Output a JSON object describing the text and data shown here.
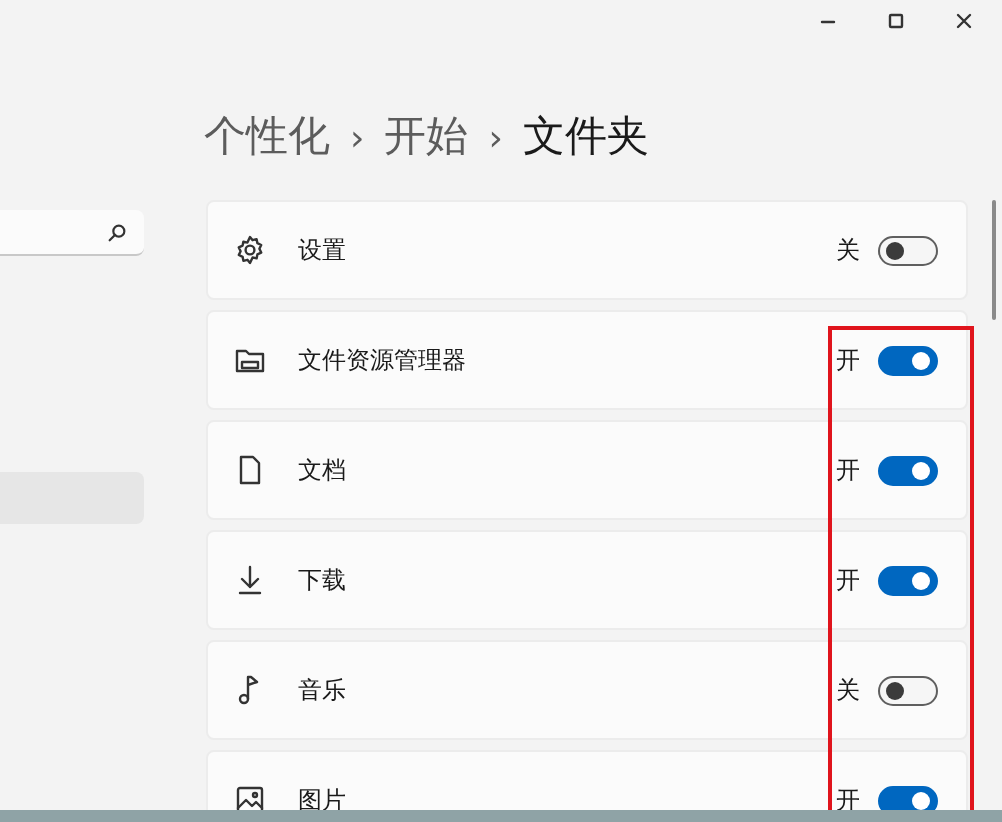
{
  "breadcrumb": [
    {
      "label": "个性化",
      "current": false
    },
    {
      "label": "开始",
      "current": false
    },
    {
      "label": "文件夹",
      "current": true
    }
  ],
  "breadcrumb_separator": "›",
  "sidebar": {
    "items": [
      {
        "selected": true
      }
    ]
  },
  "folders": [
    {
      "kind": "gear",
      "label": "设置",
      "state_text": "关",
      "on": false
    },
    {
      "kind": "explorer",
      "label": "文件资源管理器",
      "state_text": "开",
      "on": true
    },
    {
      "kind": "document",
      "label": "文档",
      "state_text": "开",
      "on": true
    },
    {
      "kind": "download",
      "label": "下载",
      "state_text": "开",
      "on": true
    },
    {
      "kind": "music",
      "label": "音乐",
      "state_text": "关",
      "on": false
    },
    {
      "kind": "picture",
      "label": "图片",
      "state_text": "开",
      "on": true
    }
  ]
}
